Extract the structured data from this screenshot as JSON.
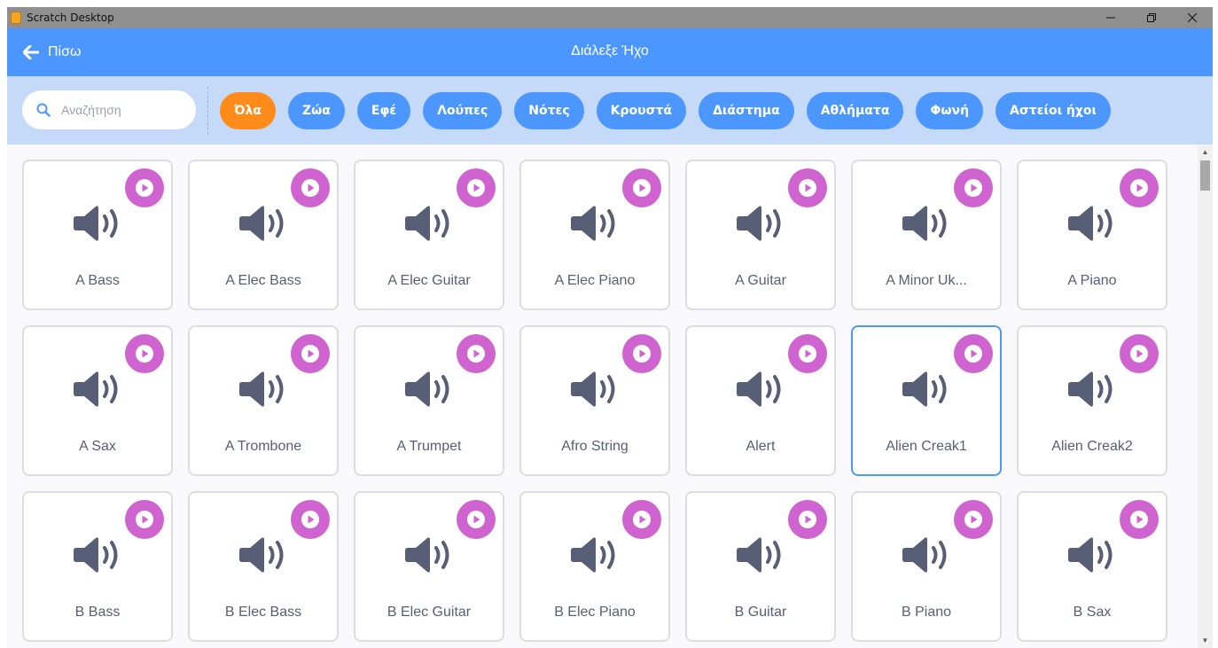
{
  "window": {
    "title": "Scratch Desktop"
  },
  "header": {
    "back_label": "Πίσω",
    "title": "Διάλεξε Ήχο"
  },
  "search": {
    "placeholder": "Αναζήτηση",
    "value": ""
  },
  "tags": [
    {
      "label": "Όλα",
      "active": true
    },
    {
      "label": "Ζώα",
      "active": false
    },
    {
      "label": "Εφέ",
      "active": false
    },
    {
      "label": "Λούπες",
      "active": false
    },
    {
      "label": "Νότες",
      "active": false
    },
    {
      "label": "Κρουστά",
      "active": false
    },
    {
      "label": "Διάστημα",
      "active": false
    },
    {
      "label": "Αθλήματα",
      "active": false
    },
    {
      "label": "Φωνή",
      "active": false
    },
    {
      "label": "Αστείοι ήχοι",
      "active": false
    }
  ],
  "sounds": [
    {
      "name": "A Bass"
    },
    {
      "name": "A Elec Bass"
    },
    {
      "name": "A Elec Guitar"
    },
    {
      "name": "A Elec Piano"
    },
    {
      "name": "A Guitar"
    },
    {
      "name": "A Minor Uk..."
    },
    {
      "name": "A Piano"
    },
    {
      "name": "A Sax"
    },
    {
      "name": "A Trombone"
    },
    {
      "name": "A Trumpet"
    },
    {
      "name": "Afro String"
    },
    {
      "name": "Alert"
    },
    {
      "name": "Alien Creak1",
      "selected": true
    },
    {
      "name": "Alien Creak2"
    },
    {
      "name": "B Bass"
    },
    {
      "name": "B Elec Bass"
    },
    {
      "name": "B Elec Guitar"
    },
    {
      "name": "B Elec Piano"
    },
    {
      "name": "B Guitar"
    },
    {
      "name": "B Piano"
    },
    {
      "name": "B Sax"
    }
  ],
  "colors": {
    "header_blue": "#4c97ff",
    "filter_bg": "#c5d9f8",
    "active_tag": "#ff8c1a",
    "play_button": "#cf63cf",
    "speaker_icon": "#575e75"
  },
  "icons": {
    "back": "arrow-left-icon",
    "search": "search-icon",
    "play": "play-icon",
    "sound": "speaker-icon"
  }
}
